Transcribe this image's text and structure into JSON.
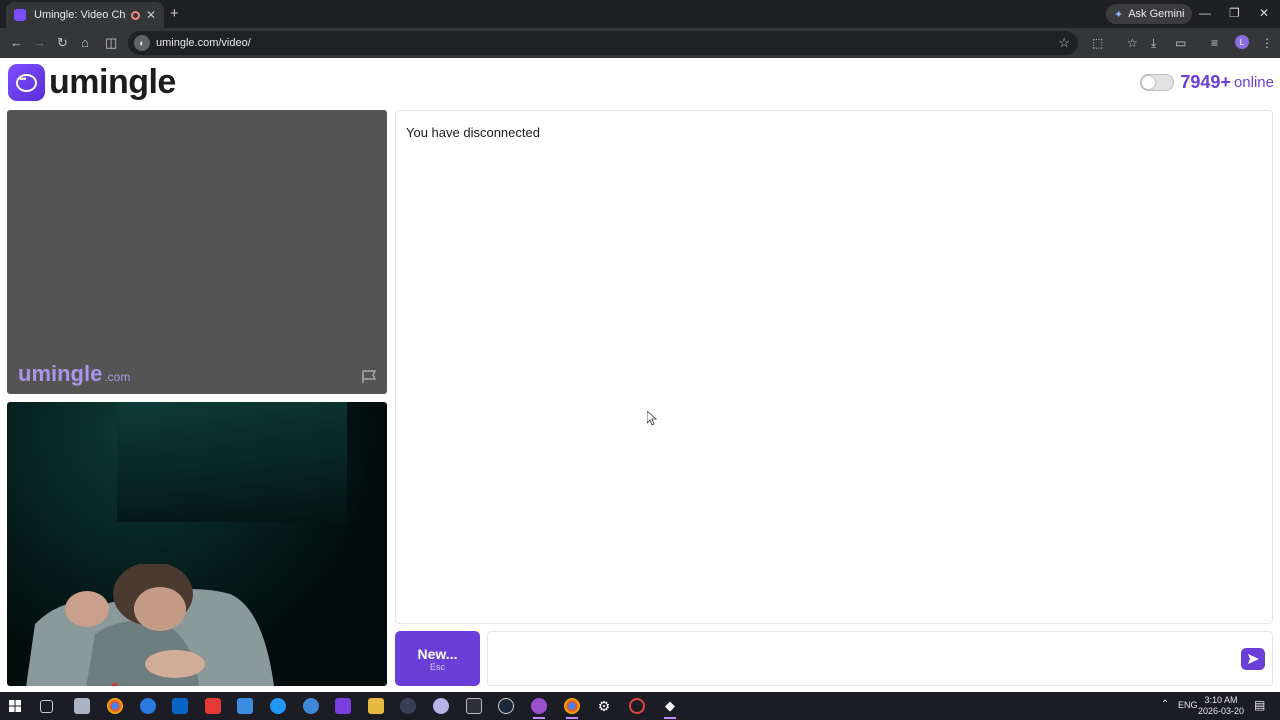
{
  "browser": {
    "tab_title": "Umingle: Video Chat with S",
    "new_tab": "+",
    "gemini_label": "Ask Gemini",
    "url": "umingle.com/video/",
    "profile_initial": "L"
  },
  "header": {
    "logo_text": "umingle",
    "online_count": "7949+",
    "online_label": "online"
  },
  "stranger_video": {
    "watermark_main": "umingle",
    "watermark_domain": ".com"
  },
  "chat": {
    "status_message": "You have disconnected",
    "input_value": "",
    "new_button_label": "New...",
    "new_button_hint": "Esc"
  },
  "taskbar": {
    "language": "ENG",
    "time": "3:10 AM",
    "date": "2026-03-20"
  },
  "colors": {
    "brand": "#6a3fd8",
    "stranger_bg": "#545454"
  },
  "icons": [
    "back-icon",
    "forward-icon",
    "reload-icon",
    "home-icon",
    "split-view-icon",
    "bookmark-star-icon",
    "extensions-icon",
    "downloads-icon",
    "report-flag-icon",
    "send-icon",
    "windows-start-icon"
  ]
}
